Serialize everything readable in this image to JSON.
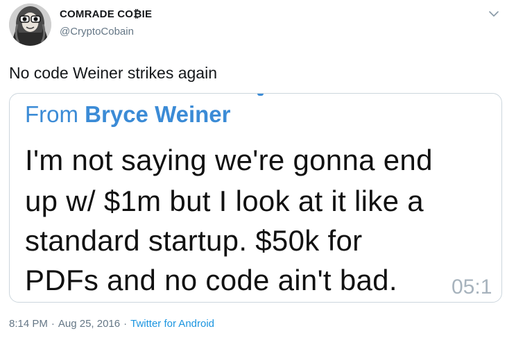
{
  "user": {
    "display_name": "COMRADE CO₿IE",
    "handle": "@CryptoCobain"
  },
  "tweet": {
    "text": "No code Weiner strikes again"
  },
  "media": {
    "from_prefix": "From ",
    "sender": "Bryce Weiner",
    "message_lines": [
      "I'm not saying we're gonna end",
      "up w/ $1m but I look at it like a",
      "standard startup.  $50k for",
      "PDFs and no code ain't bad."
    ],
    "timestamp": "05:1"
  },
  "meta": {
    "time": "8:14 PM",
    "separator": "·",
    "date": "Aug 25, 2016",
    "source": "Twitter for Android"
  },
  "colors": {
    "link_blue": "#1b95e0",
    "sender_blue": "#3b8bd6",
    "muted_gray": "#657786"
  },
  "icons": {
    "menu": "chevron-down-icon"
  }
}
